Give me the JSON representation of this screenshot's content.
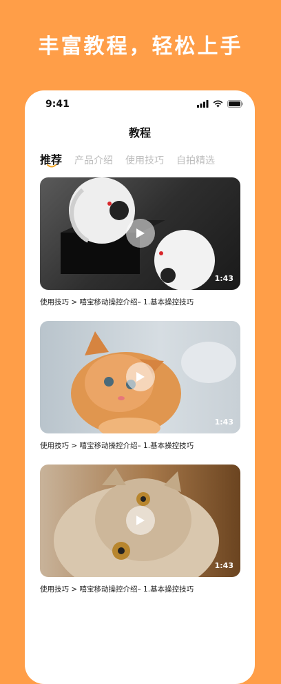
{
  "headline": "丰富教程，轻松上手",
  "status_bar": {
    "time": "9:41"
  },
  "page_title": "教程",
  "tabs": [
    {
      "label": "推荐",
      "active": true
    },
    {
      "label": "产品介绍",
      "active": false
    },
    {
      "label": "使用技巧",
      "active": false
    },
    {
      "label": "自拍精选",
      "active": false
    }
  ],
  "videos": [
    {
      "duration": "1:43",
      "caption": "使用技巧 > 嘻宝移动操控介绍– 1.基本操控技巧"
    },
    {
      "duration": "1:43",
      "caption": "使用技巧 > 嘻宝移动操控介绍– 1.基本操控技巧"
    },
    {
      "duration": "1:43",
      "caption": "使用技巧 > 嘻宝移动操控介绍– 1.基本操控技巧"
    }
  ],
  "colors": {
    "background": "#FF9E48",
    "accent": "#F5A623"
  }
}
